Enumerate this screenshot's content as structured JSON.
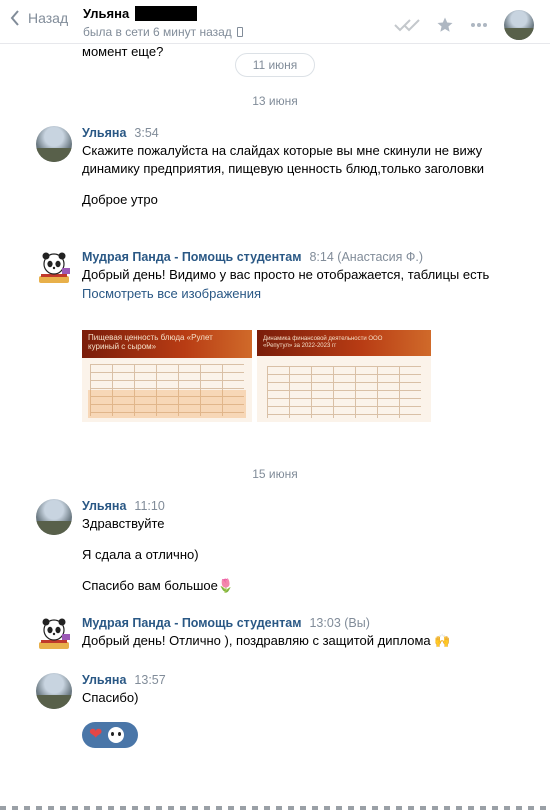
{
  "header": {
    "back_label": "Назад",
    "contact_name": "Ульяна",
    "status": "была в сети 6 минут назад"
  },
  "top_text": "момент еще?",
  "date_pill": "11 июня",
  "date_13": "13 июня",
  "date_15": "15 июня",
  "messages": [
    {
      "name": "Ульяна",
      "time": "3:54",
      "paragraphs": [
        "Скажите пожалуйста на слайдах которые вы мне скинули не вижу динамику предприятия, пищевую ценность блюд,только заголовки",
        "Доброе утро"
      ]
    },
    {
      "name": "Мудрая Панда - Помощь студентам",
      "time": "8:14 (Анастасия Ф.)",
      "paragraphs": [
        "Добрый день! Видимо у вас просто не отображается, таблицы есть"
      ],
      "link": "Посмотреть все изображения",
      "images": [
        {
          "caption": "Пищевая ценность блюда «Рулет куриный с сыром»"
        },
        {
          "caption": "Динамика финансовой деятельности ООО «Репутул» за 2022-2023 гг"
        }
      ]
    },
    {
      "name": "Ульяна",
      "time": "11:10",
      "paragraphs": [
        "Здравствуйте",
        "Я сдала а отлично)",
        "Спасибо вам большое🌷"
      ]
    },
    {
      "name": "Мудрая Панда - Помощь студентам",
      "time": "13:03 (Вы)",
      "paragraphs": [
        "Добрый день! Отлично ), поздравляю с защитой диплома 🙌"
      ]
    },
    {
      "name": "Ульяна",
      "time": "13:57",
      "paragraphs": [
        "Спасибо)"
      ]
    }
  ],
  "reactions": {
    "heart": "❤"
  },
  "colors": {
    "accent": "#2a5885",
    "muted": "#818c99",
    "reaction_bg": "#4a76a8"
  }
}
